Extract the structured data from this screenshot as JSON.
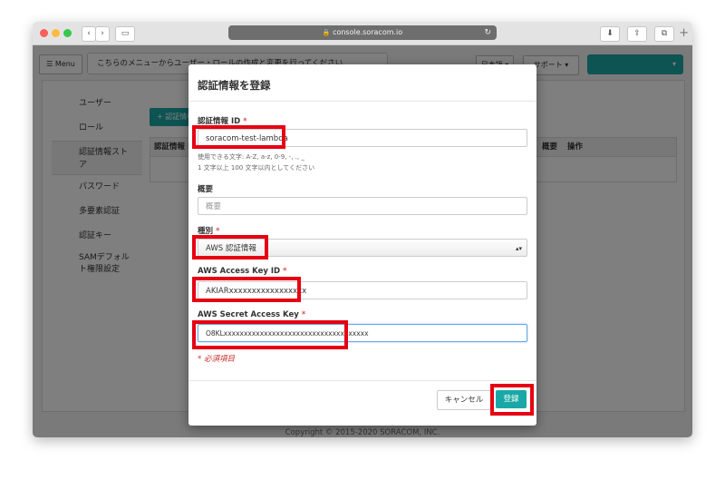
{
  "browser": {
    "url": "console.soracom.io",
    "lock_icon": "🔒",
    "reload_icon": "↻",
    "back_icon": "‹",
    "forward_icon": "›",
    "sidebar_icon": "▭",
    "download_icon": "⬇",
    "share_icon": "⇪",
    "tabs_icon": "⧉",
    "new_tab_icon": "+"
  },
  "header": {
    "menu_label": "☰ Menu",
    "tip_text": "こちらのメニューからユーザー・ロールの作成と変更を行ってください",
    "lang_label": "日本語 ▾",
    "support_label": "サポート ▾",
    "account_caret": "▾"
  },
  "sidebar": {
    "items": [
      {
        "label": "ユーザー"
      },
      {
        "label": "ロール"
      },
      {
        "label": "認証情報スト\nア"
      },
      {
        "label": "パスワード"
      },
      {
        "label": "多要素認証"
      },
      {
        "label": "認証キー"
      },
      {
        "label": "SAMデフォル\nト権限設定"
      }
    ]
  },
  "main": {
    "add_button": "+ 認証情報",
    "table_headers": [
      "認証情報 ID",
      "概要",
      "操作"
    ]
  },
  "footer": {
    "copyright": "Copyright © 2015-2020 SORACOM, INC."
  },
  "modal": {
    "title": "認証情報を登録",
    "fields": {
      "credential_id": {
        "label": "認証情報 ID",
        "value": "soracom-test-lambda",
        "help1": "使用できる文字: A-Z, a-z, 0-9, -, ., _",
        "help2": "1 文字以上 100 文字以内としてください"
      },
      "description": {
        "label": "概要",
        "placeholder": "概要"
      },
      "type": {
        "label": "種別",
        "selected": "AWS 認証情報",
        "arrows": "▴▾"
      },
      "access_key_id": {
        "label": "AWS Access Key ID",
        "value": "AKIARxxxxxxxxxxxxxxxxx"
      },
      "secret_access_key": {
        "label": "AWS Secret Access Key",
        "value": "O8KLxxxxxxxxxxxxxxxxxxxxxxxxxxxxxxxxxxxx"
      }
    },
    "required_mark": "*",
    "required_note": "* 必須項目",
    "cancel_label": "キャンセル",
    "submit_label": "登録"
  },
  "colors": {
    "accent": "#1aa8a6",
    "highlight": "#e60012",
    "required": "#d9534f"
  }
}
